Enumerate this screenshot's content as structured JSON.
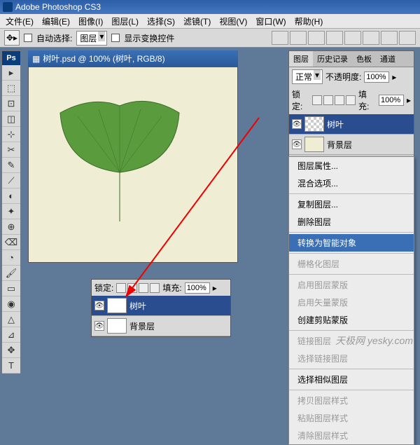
{
  "app": {
    "title": "Adobe Photoshop CS3"
  },
  "menu": {
    "file": "文件(E)",
    "edit": "编辑(E)",
    "image": "图像(I)",
    "layer": "图层(L)",
    "select": "选择(S)",
    "filter": "滤镜(T)",
    "view": "视图(V)",
    "window": "窗口(W)",
    "help": "帮助(H)"
  },
  "toolbar": {
    "autoSelect": "自动选择:",
    "target": "图层",
    "showTransform": "显示变换控件"
  },
  "doc": {
    "title": "树叶.psd @ 100% (树叶, RGB/8)"
  },
  "panel": {
    "tabs": {
      "layers": "图层",
      "history": "历史记录",
      "color": "色板",
      "channels": "通道"
    },
    "blendMode": "正常",
    "opacityLabel": "不透明度:",
    "opacityVal": "100%",
    "lockLabel": "锁定:",
    "fillLabel": "填充:",
    "fillVal": "100%",
    "layers": [
      {
        "name": "树叶",
        "selected": true,
        "checker": true
      },
      {
        "name": "背景层",
        "selected": false,
        "cream": true
      }
    ]
  },
  "floatPanel": {
    "lockLabel": "锁定:",
    "fillLabel": "填充:",
    "fillVal": "100%",
    "layers": [
      {
        "name": "树叶",
        "selected": true
      },
      {
        "name": "背景层",
        "selected": false
      }
    ]
  },
  "contextMenu": {
    "items": [
      {
        "label": "图层属性...",
        "type": "normal"
      },
      {
        "label": "混合选项...",
        "type": "normal"
      },
      {
        "type": "sep"
      },
      {
        "label": "复制图层...",
        "type": "normal"
      },
      {
        "label": "删除图层",
        "type": "normal"
      },
      {
        "type": "sep"
      },
      {
        "label": "转换为智能对象",
        "type": "selected"
      },
      {
        "type": "sep"
      },
      {
        "label": "栅格化图层",
        "type": "disabled"
      },
      {
        "type": "sep"
      },
      {
        "label": "启用图层蒙版",
        "type": "disabled"
      },
      {
        "label": "启用矢量蒙版",
        "type": "disabled"
      },
      {
        "label": "创建剪贴蒙版",
        "type": "normal"
      },
      {
        "type": "sep"
      },
      {
        "label": "链接图层",
        "type": "disabled"
      },
      {
        "label": "选择链接图层",
        "type": "disabled"
      },
      {
        "type": "sep"
      },
      {
        "label": "选择相似图层",
        "type": "normal"
      },
      {
        "type": "sep"
      },
      {
        "label": "拷贝图层样式",
        "type": "disabled"
      },
      {
        "label": "粘贴图层样式",
        "type": "disabled"
      },
      {
        "label": "清除图层样式",
        "type": "disabled"
      }
    ]
  },
  "tools": [
    "▸",
    "⬚",
    "⊡",
    "◫",
    "⊹",
    "✂",
    "✎",
    "⟋",
    "◐",
    "✦",
    "⊕",
    "⌫",
    "◔",
    "🖌",
    "▭",
    "◉",
    "△",
    "⊿",
    "✥",
    "T"
  ],
  "watermark": "天极网 yesky.com"
}
